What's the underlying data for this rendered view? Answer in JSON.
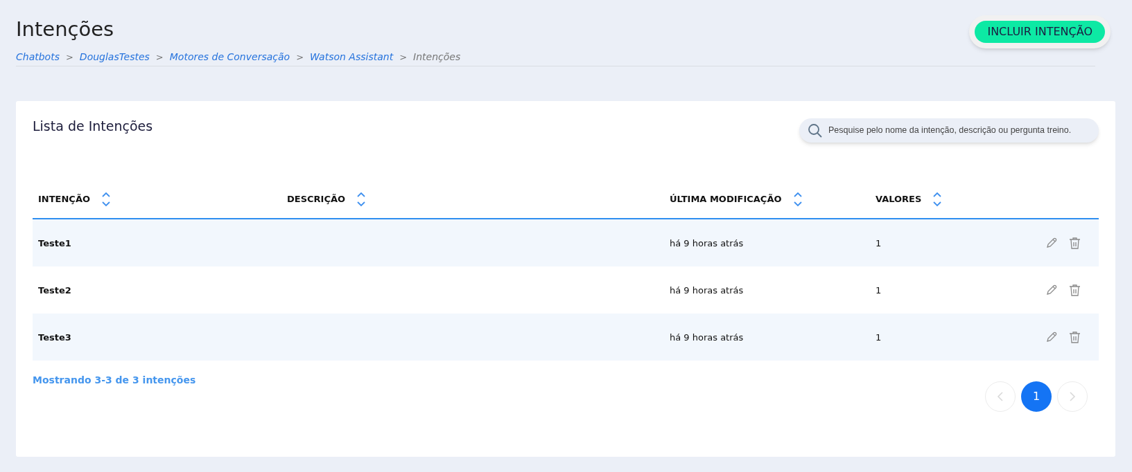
{
  "page_title": "Intenções",
  "add_button": "INCLUIR INTENÇÃO",
  "breadcrumb": [
    {
      "label": "Chatbots",
      "current": false
    },
    {
      "label": "DouglasTestes",
      "current": false
    },
    {
      "label": "Motores de Conversação",
      "current": false
    },
    {
      "label": "Watson Assistant",
      "current": false
    },
    {
      "label": "Intenções",
      "current": true
    }
  ],
  "breadcrumb_separator": ">",
  "card": {
    "title": "Lista de Intenções",
    "search": {
      "placeholder": "Pesquise pelo nome da intenção, descrição ou pergunta treino."
    }
  },
  "table": {
    "columns": [
      "INTENÇÃO",
      "DESCRIÇÃO",
      "ÚLTIMA MODIFICAÇÃO",
      "VALORES"
    ],
    "rows": [
      {
        "name": "Teste1",
        "description": "",
        "modified": "há 9 horas atrás",
        "values": "1"
      },
      {
        "name": "Teste2",
        "description": "",
        "modified": "há 9 horas atrás",
        "values": "1"
      },
      {
        "name": "Teste3",
        "description": "",
        "modified": "há 9 horas atrás",
        "values": "1"
      }
    ]
  },
  "footer": "Mostrando 3-3 de 3 intenções",
  "pagination": {
    "prev_disabled": true,
    "next_disabled": true,
    "pages": [
      {
        "label": "1",
        "selected": true
      }
    ]
  }
}
